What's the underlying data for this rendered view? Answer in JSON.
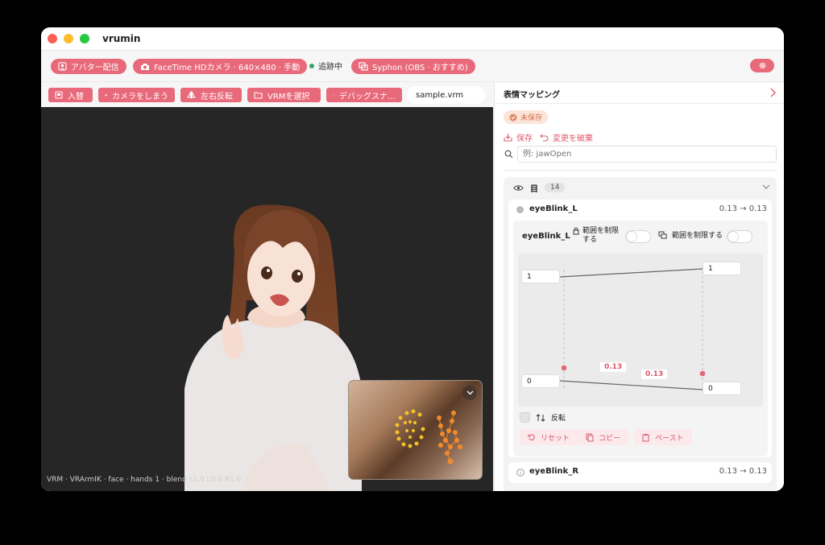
{
  "window": {
    "title": "vrumin"
  },
  "topbar": {
    "avatar_stream": "アバター配信",
    "camera": "FaceTime HDカメラ · 640×480 · 手動",
    "tracking_status": "追跡中",
    "syphon": "Syphon (OBS · おすすめ)"
  },
  "toolbar": {
    "swap": "入替",
    "hide_camera": "カメラをしまう",
    "mirror": "左右反転",
    "select_vrm": "VRMを選択",
    "debug_snapshot": "デバッグスナ…",
    "vrm_file": "sample.vrm"
  },
  "viewport": {
    "status": "VRM · VRArmIK · face · hands 1 · blend s1.0 L0.0 R1.0"
  },
  "panel": {
    "title": "表情マッピング",
    "unsaved": "未保存",
    "save": "保存",
    "discard": "変更を破棄",
    "search_placeholder": "例: jawOpen",
    "group": {
      "name": "目",
      "count": "14"
    },
    "item1": {
      "name": "eyeBlink_L",
      "range": "0.13 → 0.13",
      "editor_name": "eyeBlink_L",
      "clamp_input_label": "範囲を制限する",
      "clamp_output_label": "範囲を制限する",
      "in_max": "1",
      "out_max": "1",
      "in_min": "0",
      "out_min": "0",
      "input_value": "0.13",
      "output_value": "0.13",
      "invert": "反転",
      "reset": "リセット",
      "copy": "コピー",
      "paste": "ペースト"
    },
    "item2": {
      "name": "eyeBlink_R",
      "range": "0.13 → 0.13"
    }
  },
  "colors": {
    "accent": "#e8697a",
    "tracking": "#3aa56b",
    "unsaved": "#d5704a"
  },
  "icons": [
    "avatar-icon",
    "camera-icon",
    "syphon-icon",
    "gear-icon",
    "swap-icon",
    "camera-hide-icon",
    "mirror-icon",
    "folder-icon",
    "debug-icon",
    "chevron-right-icon",
    "check-icon",
    "save-icon",
    "undo-icon",
    "search-icon",
    "eye-icon",
    "chevron-down-icon",
    "lock-icon",
    "clamp-icon",
    "sort-icon",
    "reset-icon",
    "copy-icon",
    "paste-icon",
    "info-icon"
  ]
}
